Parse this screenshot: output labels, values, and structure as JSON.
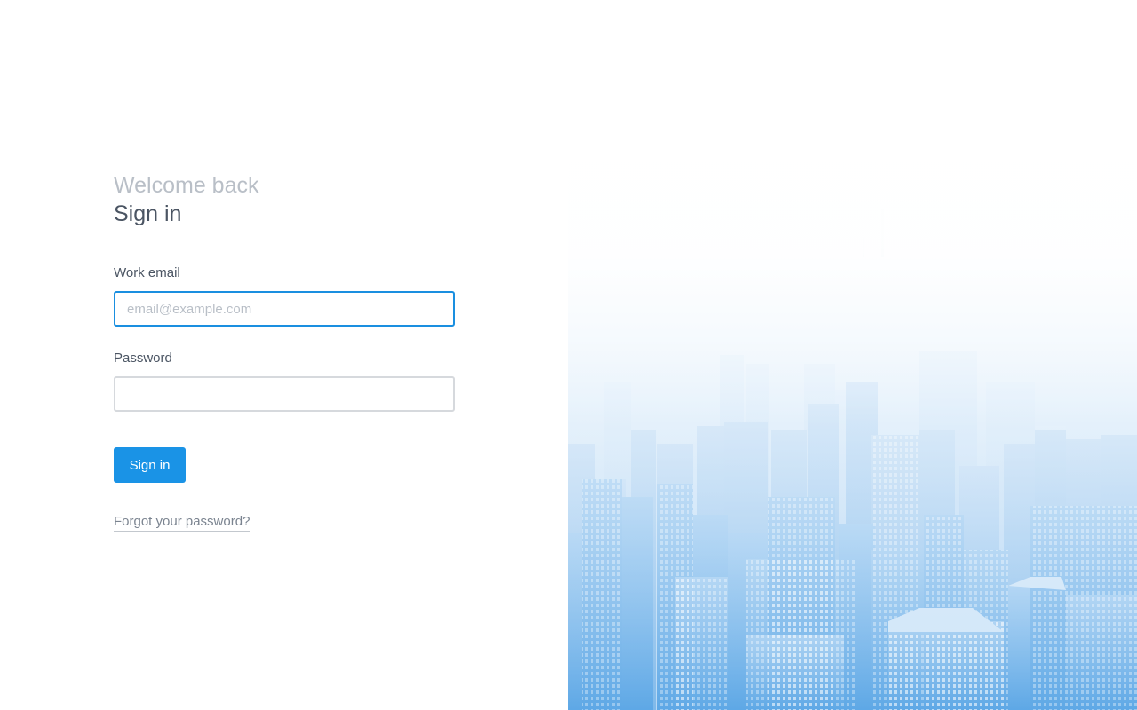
{
  "login": {
    "welcome_text": "Welcome back",
    "title": "Sign in",
    "email_label": "Work email",
    "email_placeholder": "email@example.com",
    "email_value": "",
    "password_label": "Password",
    "password_value": "",
    "submit_label": "Sign in",
    "forgot_link": "Forgot your password?"
  },
  "hero": {
    "image": "city-skyline-illustration"
  },
  "colors": {
    "accent": "#1a93e6",
    "focus_border": "#1a8fe0",
    "heading": "#4b5563",
    "muted": "#b9bfc7",
    "link": "#7b8490",
    "hero_tint": "#b6d8f5"
  }
}
